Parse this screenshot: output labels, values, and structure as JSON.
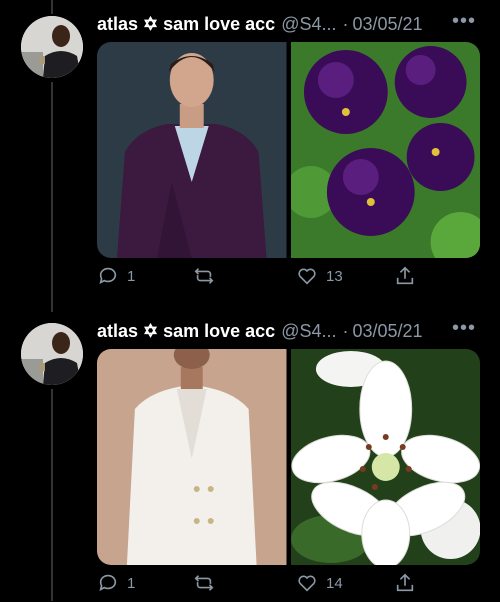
{
  "tweets": [
    {
      "display_name": "atlas ✡ sam love acc",
      "handle": "@S4...",
      "separator": "·",
      "date": "03/05/21",
      "more": "•••",
      "replies": "1",
      "retweets": "",
      "likes": "13",
      "media": [
        {
          "subject": "man-in-purple-suit",
          "bg": "#2a3a47",
          "accent": "#4a1f4f"
        },
        {
          "subject": "purple-pansies",
          "bg": "#2f6a22",
          "accent": "#3d0f5c"
        }
      ]
    },
    {
      "display_name": "atlas ✡ sam love acc",
      "handle": "@S4...",
      "separator": "·",
      "date": "03/05/21",
      "more": "•••",
      "replies": "1",
      "retweets": "",
      "likes": "14",
      "media": [
        {
          "subject": "man-in-white-suit",
          "bg": "#c9a892",
          "accent": "#f4f2ef"
        },
        {
          "subject": "white-lily",
          "bg": "#2a4a20",
          "accent": "#ffffff"
        }
      ]
    }
  ],
  "colors": {
    "background": "#000000",
    "text_secondary": "#8b98a5",
    "thread_line": "#333333"
  },
  "icons": [
    "reply-icon",
    "retweet-icon",
    "like-icon",
    "share-icon",
    "more-icon"
  ]
}
